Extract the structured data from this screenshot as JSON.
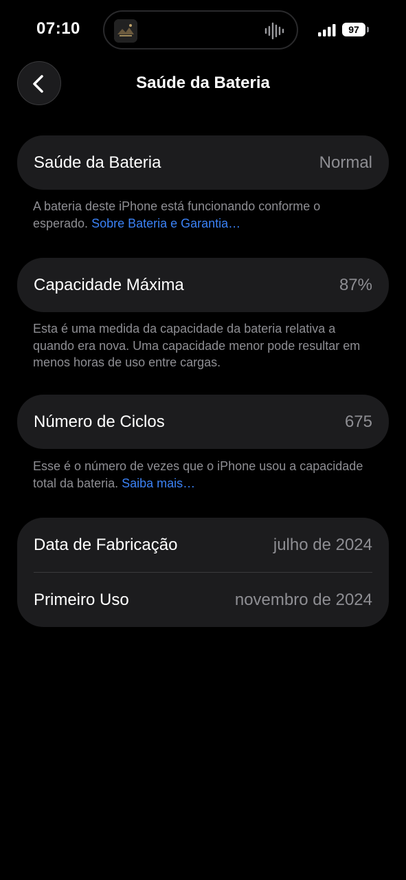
{
  "status_bar": {
    "time": "07:10",
    "battery_level": "97",
    "signal_bars": 4
  },
  "nav": {
    "title": "Saúde da Bateria"
  },
  "battery_health": {
    "label": "Saúde da Bateria",
    "value": "Normal",
    "footnote_text": "A bateria deste iPhone está funcionando conforme o esperado. ",
    "footnote_link": "Sobre Bateria e Garantia…"
  },
  "max_capacity": {
    "label": "Capacidade Máxima",
    "value": "87%",
    "footnote_text": "Esta é uma medida da capacidade da bateria relativa a quando era nova. Uma capacidade menor pode resultar em menos horas de uso entre cargas."
  },
  "cycle_count": {
    "label": "Número de Ciclos",
    "value": "675",
    "footnote_text": "Esse é o número de vezes que o iPhone usou a capacidade total da bateria. ",
    "footnote_link": "Saiba mais…"
  },
  "dates": {
    "manufacture_label": "Data de Fabricação",
    "manufacture_value": "julho de 2024",
    "first_use_label": "Primeiro Uso",
    "first_use_value": "novembro de 2024"
  },
  "colors": {
    "background": "#000000",
    "card": "#1c1c1e",
    "secondary_text": "#8e8e93",
    "link": "#3b82f6"
  }
}
